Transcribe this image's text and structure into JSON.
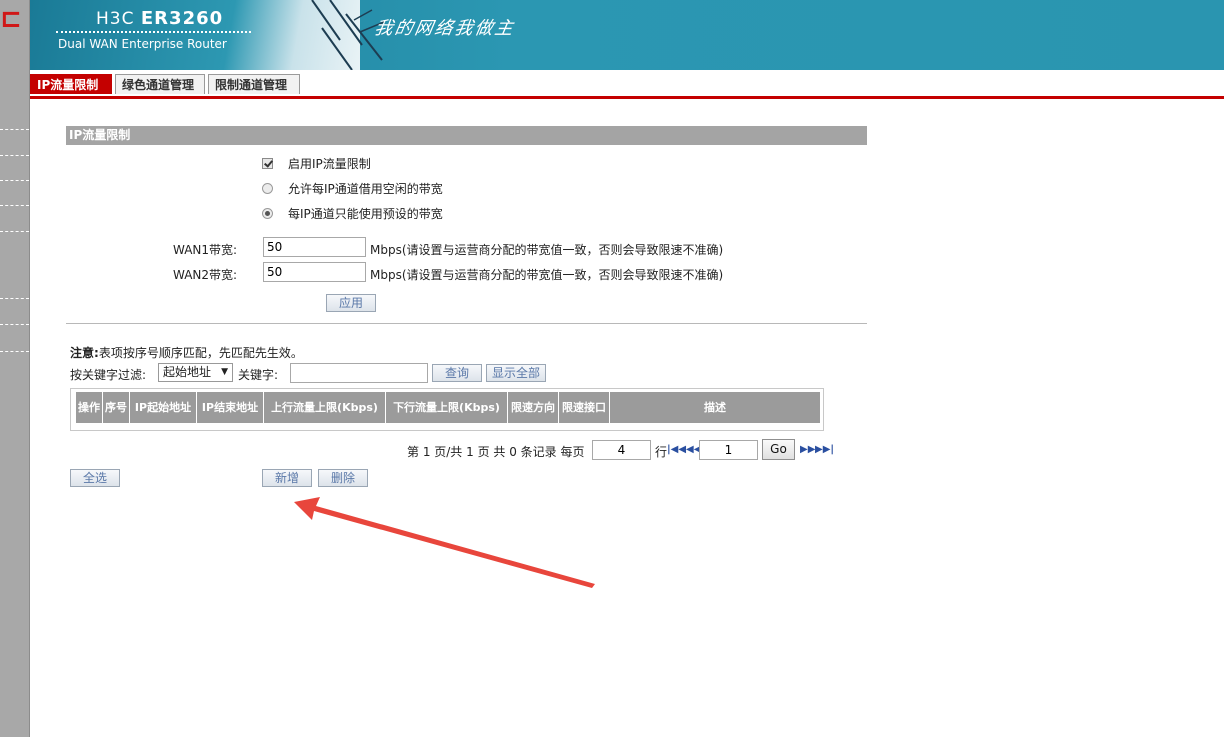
{
  "banner": {
    "model_prefix": "H3C",
    "model": "ER3260",
    "subtitle": "Dual WAN Enterprise Router",
    "slogan": "我的网络我做主"
  },
  "tabs": [
    {
      "label": "IP流量限制",
      "active": true
    },
    {
      "label": "绿色通道管理",
      "active": false
    },
    {
      "label": "限制通道管理",
      "active": false
    }
  ],
  "section": {
    "title": "IP流量限制",
    "enable_label": "启用IP流量限制",
    "enable_checked": true,
    "radio_borrow_label": "允许每IP通道借用空闲的带宽",
    "radio_fixed_label": "每IP通道只能使用预设的带宽",
    "radio_selected": "fixed"
  },
  "wan1": {
    "label": "WAN1带宽:",
    "value": "50",
    "unit_note": "Mbps(请设置与运营商分配的带宽值一致，否则会导致限速不准确)"
  },
  "wan2": {
    "label": "WAN2带宽:",
    "value": "50",
    "unit_note": "Mbps(请设置与运营商分配的带宽值一致，否则会导致限速不准确)"
  },
  "apply_label": "应用",
  "note": {
    "bold": "注意:",
    "text": "表项按序号顺序匹配，先匹配先生效。"
  },
  "filter": {
    "label": "按关键字过滤:",
    "select_value": "起始地址",
    "keyword_label": "关键字:",
    "keyword_value": "",
    "search_label": "查询",
    "show_all_label": "显示全部"
  },
  "table": {
    "columns": [
      "操作",
      "序号",
      "IP起始地址",
      "IP结束地址",
      "上行流量上限(Kbps)",
      "下行流量上限(Kbps)",
      "限速方向",
      "限速接口",
      "描述"
    ]
  },
  "pager": {
    "text_before": "第 1 页/共 1 页 共 0 条记录 每页",
    "per_page": "4",
    "rows_label": "行",
    "page_value": "1",
    "go_label": "Go"
  },
  "bottom": {
    "select_all_label": "全选",
    "add_label": "新增",
    "delete_label": "删除"
  },
  "colors": {
    "accent_red": "#c40000",
    "banner_teal": "#2a95b0",
    "header_gray": "#a4a4a4",
    "annotation_arrow": "#e8463c"
  }
}
